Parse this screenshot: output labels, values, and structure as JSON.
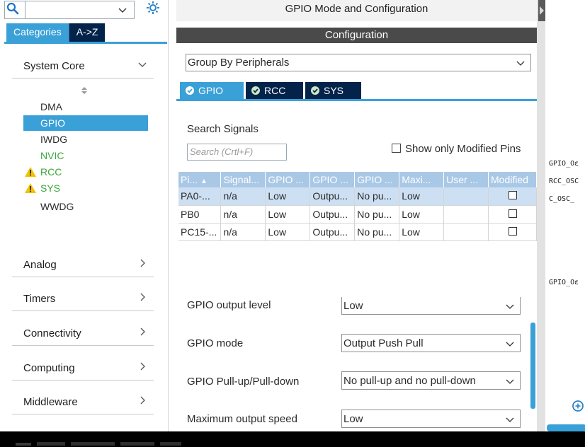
{
  "sidebar": {
    "search": {
      "value": "",
      "placeholder": ""
    },
    "tabs": {
      "categories": "Categories",
      "az": "A->Z"
    },
    "categories": [
      {
        "label": "System Core",
        "expanded": true
      },
      {
        "label": "Analog",
        "expanded": false
      },
      {
        "label": "Timers",
        "expanded": false
      },
      {
        "label": "Connectivity",
        "expanded": false
      },
      {
        "label": "Computing",
        "expanded": false
      },
      {
        "label": "Middleware",
        "expanded": false
      }
    ],
    "system_core_items": [
      {
        "label": "DMA",
        "state": "normal"
      },
      {
        "label": "GPIO",
        "state": "selected"
      },
      {
        "label": "IWDG",
        "state": "normal"
      },
      {
        "label": "NVIC",
        "state": "enabled"
      },
      {
        "label": "RCC",
        "state": "warning"
      },
      {
        "label": "SYS",
        "state": "warning"
      },
      {
        "label": "WWDG",
        "state": "normal"
      }
    ]
  },
  "main": {
    "title": "GPIO Mode and Configuration",
    "configuration_header": "Configuration",
    "group_by": "Group By Peripherals",
    "peripheral_tabs": [
      {
        "label": "GPIO",
        "active": true
      },
      {
        "label": "RCC",
        "active": false
      },
      {
        "label": "SYS",
        "active": false
      }
    ],
    "search_signals_label": "Search Signals",
    "search_signals_placeholder": "Search (Crtl+F)",
    "show_only_modified": "Show only Modified Pins",
    "table": {
      "headers": [
        "Pi...",
        "Signal...",
        "GPIO ...",
        "GPIO ...",
        "GPIO ...",
        "Maxi...",
        "User ...",
        "Modified"
      ],
      "rows": [
        {
          "pin": "PA0-...",
          "signal": "n/a",
          "level": "Low",
          "mode": "Outpu...",
          "pull": "No pu...",
          "speed": "Low",
          "user": "",
          "modified": false,
          "selected": true
        },
        {
          "pin": "PB0",
          "signal": "n/a",
          "level": "Low",
          "mode": "Outpu...",
          "pull": "No pu...",
          "speed": "Low",
          "user": "",
          "modified": false,
          "selected": false
        },
        {
          "pin": "PC15-...",
          "signal": "n/a",
          "level": "Low",
          "mode": "Outpu...",
          "pull": "No pu...",
          "speed": "Low",
          "user": "",
          "modified": false,
          "selected": false
        }
      ]
    },
    "config_fields": [
      {
        "label": "GPIO output level",
        "value": "Low"
      },
      {
        "label": "GPIO mode",
        "value": "Output Push Pull"
      },
      {
        "label": "GPIO Pull-up/Pull-down",
        "value": "No pull-up and no pull-down"
      },
      {
        "label": "Maximum output speed",
        "value": "Low"
      }
    ]
  },
  "pinout": {
    "labels": [
      "GPIO_Oε",
      "RCC_OSC",
      "C_OSC_",
      "GPIO_Oε"
    ]
  },
  "colors": {
    "accent": "#3aa0d8",
    "dark_tab": "#03234b",
    "config_bar": "#4a4a4a",
    "table_header": "#a9c8e6",
    "selected_row": "#cde0f3",
    "enabled_green": "#3aa83a",
    "warning_yellow": "#f2c200"
  }
}
